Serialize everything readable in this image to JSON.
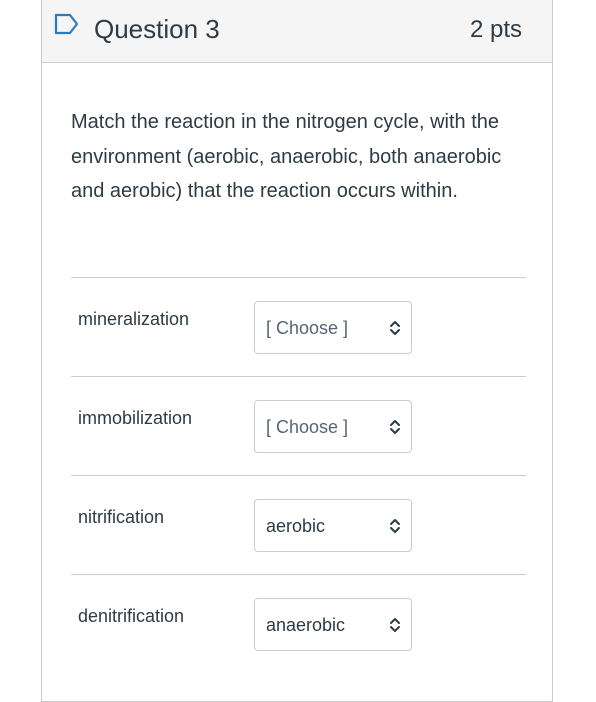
{
  "question": {
    "title": "Question 3",
    "points": "2 pts",
    "prompt": "Match the reaction in the nitrogen cycle, with the environment (aerobic, anaerobic, both anaerobic and aerobic) that the reaction occurs within."
  },
  "matches": [
    {
      "label": "mineralization",
      "selected": "[ Choose ]",
      "is_placeholder": true
    },
    {
      "label": "immobilization",
      "selected": "[ Choose ]",
      "is_placeholder": true
    },
    {
      "label": "nitrification",
      "selected": "aerobic",
      "is_placeholder": false
    },
    {
      "label": "denitrification",
      "selected": "anaerobic",
      "is_placeholder": false
    }
  ],
  "icons": {
    "flag": "bookmark-flag-icon",
    "select_arrows": "chevron-updown-icon"
  },
  "colors": {
    "text": "#2d3b45",
    "border": "#c7cdd1",
    "header_bg": "#f5f5f5",
    "flag_stroke": "#2b7abc"
  }
}
